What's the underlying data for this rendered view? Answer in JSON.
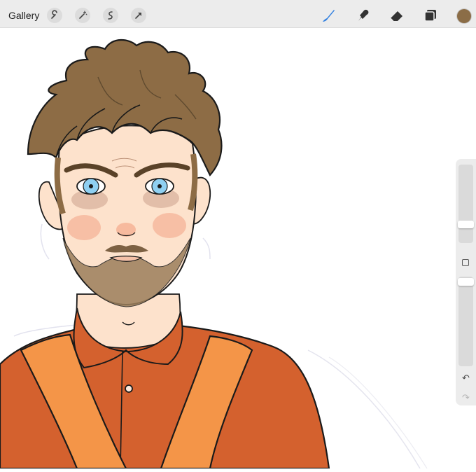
{
  "toolbar": {
    "gallery_label": "Gallery",
    "left_tools": [
      "wrench-icon",
      "magic-wand-icon",
      "selection-icon",
      "transform-arrow-icon"
    ],
    "right_tools": [
      "brush-icon",
      "smudge-icon",
      "eraser-icon",
      "layers-icon"
    ],
    "active_tool": "brush-icon",
    "active_color": "#8b6d47",
    "brush_icon_color": "#2f7fe0"
  },
  "sidebar": {
    "brush_size": 0.21,
    "opacity": 0.98,
    "undo_icon": "undo-arrow-icon",
    "redo_icon": "redo-arrow-icon"
  },
  "canvas": {
    "background": "#ffffff",
    "artwork_subject": "artwork-bearded-man-portrait"
  }
}
